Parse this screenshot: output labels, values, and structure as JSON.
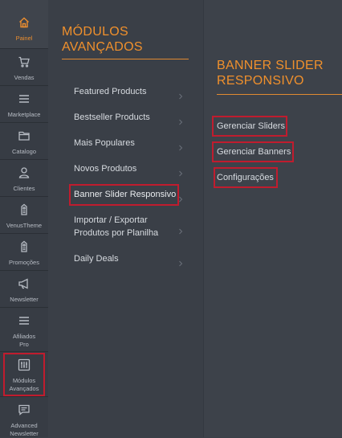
{
  "sidebar": {
    "items": [
      {
        "label": "Painel",
        "icon": "home-icon",
        "active": true
      },
      {
        "label": "Vendas",
        "icon": "cart-icon"
      },
      {
        "label": "Marketplace",
        "icon": "menu-icon"
      },
      {
        "label": "Catalogo",
        "icon": "folder-icon"
      },
      {
        "label": "Clientes",
        "icon": "user-icon"
      },
      {
        "label": "VenusTheme",
        "icon": "tag-icon"
      },
      {
        "label": "Promoções",
        "icon": "tag-icon"
      },
      {
        "label": "Newsletter",
        "icon": "megaphone-icon"
      },
      {
        "label": "Afiliados Pro",
        "icon": "menu-icon"
      },
      {
        "label": "Módulos Avançados",
        "icon": "sliders-icon"
      },
      {
        "label": "Advanced Newsletter",
        "icon": "message-icon"
      }
    ]
  },
  "submenu": {
    "title": "MÓDULOS AVANÇADOS",
    "items": [
      {
        "label": "Featured Products"
      },
      {
        "label": "Bestseller Products"
      },
      {
        "label": "Mais Populares"
      },
      {
        "label": "Novos Produtos"
      },
      {
        "label": "Banner Slider Responsivo",
        "highlighted": true
      },
      {
        "label": "Importar / Exportar Produtos por Planilha"
      },
      {
        "label": "Daily Deals"
      }
    ]
  },
  "flyout": {
    "title": "BANNER SLIDER RESPONSIVO",
    "links": [
      {
        "label": "Gerenciar Sliders"
      },
      {
        "label": "Gerenciar Banners"
      },
      {
        "label": "Configurações"
      }
    ]
  },
  "colors": {
    "accent": "#f0902c",
    "highlight_box": "#c01c2e",
    "sidebar_bg": "#373c44",
    "panel_bg": "#3a3f47"
  }
}
